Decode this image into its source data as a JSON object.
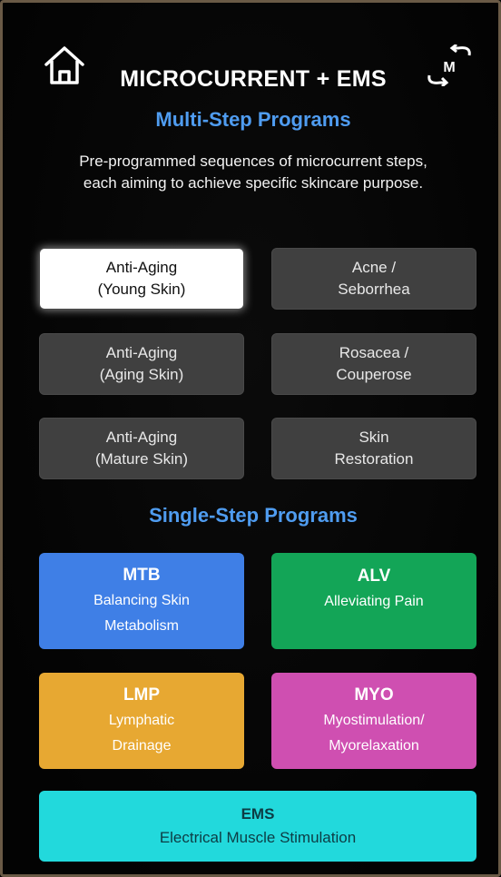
{
  "header": {
    "title": "MICROCURRENT + EMS",
    "left_icon": "home-icon",
    "right_icon": "mode-switch-icon",
    "right_icon_text": "M"
  },
  "multi_step": {
    "title": "Multi-Step Programs",
    "description_line1": "Pre-programmed sequences of microcurrent steps,",
    "description_line2": "each aiming to achieve specific skincare purpose.",
    "programs": [
      {
        "line1": "Anti-Aging",
        "line2": "(Young Skin)",
        "selected": true
      },
      {
        "line1": "Acne /",
        "line2": "Seborrhea",
        "selected": false
      },
      {
        "line1": "Anti-Aging",
        "line2": "(Aging Skin)",
        "selected": false
      },
      {
        "line1": "Rosacea /",
        "line2": "Couperose",
        "selected": false
      },
      {
        "line1": "Anti-Aging",
        "line2": "(Mature Skin)",
        "selected": false
      },
      {
        "line1": "Skin",
        "line2": "Restoration",
        "selected": false
      }
    ]
  },
  "single_step": {
    "title": "Single-Step Programs",
    "programs": [
      {
        "code": "MTB",
        "line1": "Balancing Skin",
        "line2": "Metabolism",
        "color": "#3f7fe6"
      },
      {
        "code": "ALV",
        "line1": "Alleviating Pain",
        "line2": "",
        "color": "#13a557"
      },
      {
        "code": "LMP",
        "line1": "Lymphatic",
        "line2": "Drainage",
        "color": "#e7a832"
      },
      {
        "code": "MYO",
        "line1": "Myostimulation/",
        "line2": "Myorelaxation",
        "color": "#cf4fb1"
      },
      {
        "code": "EMS",
        "line1": "Electrical Muscle Stimulation",
        "line2": "",
        "color": "#22d9dc"
      }
    ]
  },
  "colors": {
    "background": "#050505",
    "accent_blue": "#4f9cf0",
    "button_gray": "#404040",
    "selected_button": "#ffffff"
  }
}
